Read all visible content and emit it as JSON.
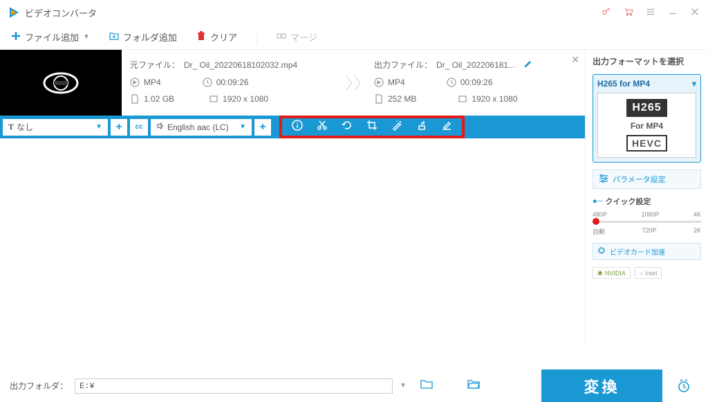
{
  "app": {
    "title": "ビデオコンバータ"
  },
  "toolbar": {
    "add_file": "ファイル追加",
    "add_folder": "フォルダ追加",
    "clear": "クリア",
    "merge": "マージ"
  },
  "file": {
    "src": {
      "label": "元ファイル：",
      "name": "Dr_ Oil_20220618102032.mp4",
      "format": "MP4",
      "duration": "00:09:26",
      "size": "1.02 GB",
      "resolution": "1920 x 1080"
    },
    "dst": {
      "label": "出力ファイル：",
      "name": "Dr_ Oil_202206181...",
      "format": "MP4",
      "duration": "00:09:26",
      "size": "252 MB",
      "resolution": "1920 x 1080"
    }
  },
  "controls": {
    "subtitle": "なし",
    "audio": "English aac (LC)"
  },
  "right": {
    "title": "出力フォーマットを選択",
    "format_name": "H265 for MP4",
    "h265": "H265",
    "for_mp4": "For MP4",
    "hevc": "HEVC",
    "param": "パラメータ設定",
    "quick": "クイック設定",
    "ticks_top": [
      "480P",
      "1080P",
      "4K"
    ],
    "ticks_bot": [
      "自動",
      "720P",
      "2K"
    ],
    "gpu": "ビデオカード加速",
    "nvidia": "NVIDIA",
    "intel": "Intel"
  },
  "bottom": {
    "label": "出力フォルダ：",
    "path": "E:¥",
    "convert": "変換"
  }
}
